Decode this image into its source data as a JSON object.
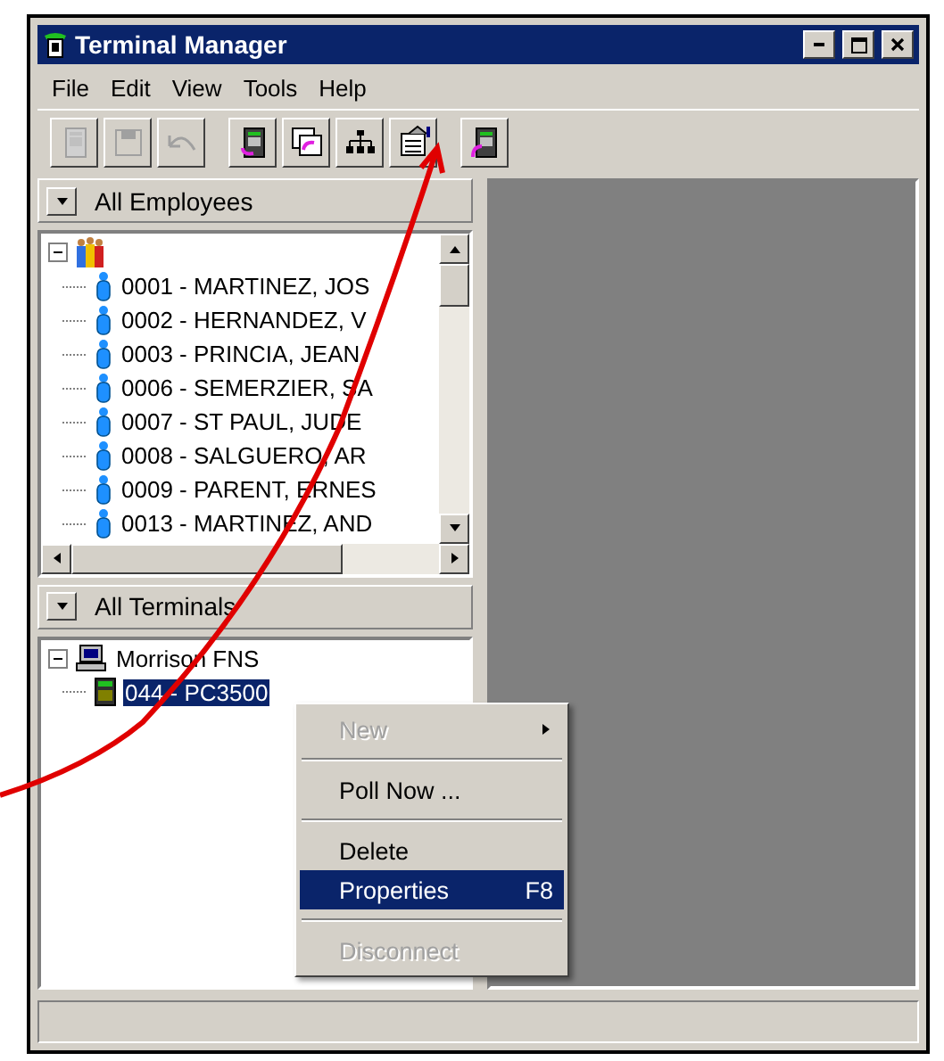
{
  "window": {
    "title": "Terminal Manager"
  },
  "menu": [
    "File",
    "Edit",
    "View",
    "Tools",
    "Help"
  ],
  "toolbar": [
    {
      "kind": "terminal",
      "disabled": true
    },
    {
      "kind": "save",
      "disabled": true
    },
    {
      "kind": "undo",
      "disabled": true
    },
    {
      "kind": "sep"
    },
    {
      "kind": "receive",
      "disabled": false
    },
    {
      "kind": "copy",
      "disabled": false
    },
    {
      "kind": "tree",
      "disabled": false
    },
    {
      "kind": "properties",
      "disabled": false
    },
    {
      "kind": "sep"
    },
    {
      "kind": "send",
      "disabled": false
    }
  ],
  "employees": {
    "header": "All Employees",
    "root": {
      "expanded": true,
      "children": [
        {
          "label": "0001 - MARTINEZ, JOS"
        },
        {
          "label": "0002 - HERNANDEZ, V"
        },
        {
          "label": "0003 - PRINCIA, JEAN"
        },
        {
          "label": "0006 - SEMERZIER, SA"
        },
        {
          "label": "0007 - ST PAUL, JUDE"
        },
        {
          "label": "0008 - SALGUERO, AR"
        },
        {
          "label": "0009 - PARENT, ERNES"
        },
        {
          "label": "0013 - MARTINEZ, AND"
        }
      ]
    }
  },
  "terminals": {
    "header": "All Terminals",
    "root": {
      "label": "Morrison FNS",
      "expanded": true,
      "children": [
        {
          "label": "044 - PC3500",
          "selected": true
        }
      ]
    }
  },
  "context_menu": [
    {
      "kind": "item",
      "label": "New",
      "disabled": true,
      "submenu": true,
      "selected": false
    },
    {
      "kind": "separator"
    },
    {
      "kind": "item",
      "label": "Poll Now ...",
      "disabled": false,
      "selected": false
    },
    {
      "kind": "separator"
    },
    {
      "kind": "item",
      "label": "Delete",
      "disabled": false,
      "selected": false
    },
    {
      "kind": "item",
      "label": "Properties",
      "shortcut": "F8",
      "disabled": false,
      "selected": true
    },
    {
      "kind": "separator"
    },
    {
      "kind": "item",
      "label": "Disconnect",
      "disabled": true,
      "selected": false
    }
  ]
}
